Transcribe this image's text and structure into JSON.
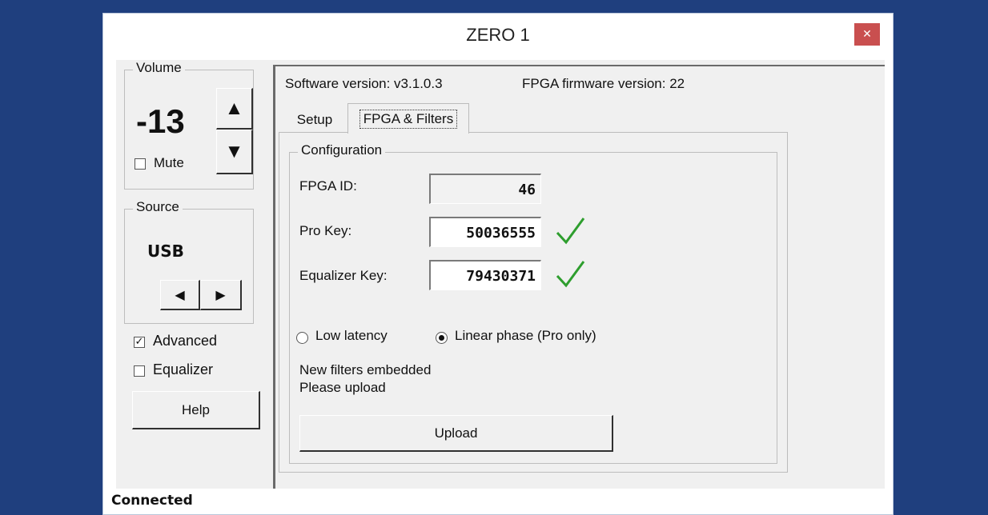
{
  "window": {
    "title": "ZERO 1",
    "close_icon": "close-icon"
  },
  "volume": {
    "label": "Volume",
    "value": "-13",
    "mute_label": "Mute",
    "mute_checked": false,
    "up_icon": "up-arrow-icon",
    "down_icon": "down-arrow-icon"
  },
  "source": {
    "label": "Source",
    "value": "USB",
    "prev_icon": "left-arrow-icon",
    "next_icon": "right-arrow-icon"
  },
  "options": {
    "advanced_label": "Advanced",
    "advanced_checked": true,
    "equalizer_label": "Equalizer",
    "equalizer_checked": false,
    "help_label": "Help"
  },
  "info": {
    "software_version": "Software version: v3.1.0.3",
    "fpga_version": "FPGA firmware version:  22"
  },
  "tabs": [
    {
      "label": "Setup",
      "active": false
    },
    {
      "label": "FPGA & Filters",
      "active": true
    }
  ],
  "config": {
    "group_label": "Configuration",
    "fpga_id_label": "FPGA ID:",
    "fpga_id_value": "46",
    "pro_key_label": "Pro Key:",
    "pro_key_value": "50036555",
    "eq_key_label": "Equalizer Key:",
    "eq_key_value": "79430371",
    "valid_icon": "checkmark-icon",
    "valid_color": "#2e9e2e",
    "low_latency_label": "Low latency",
    "linear_phase_label": "Linear phase (Pro only)",
    "selected_filter": "linear_phase",
    "message_line1": "New filters embedded",
    "message_line2": "Please upload",
    "upload_label": "Upload"
  },
  "status": {
    "text": "Connected"
  },
  "colors": {
    "desktop": "#1f3f7e",
    "close_button": "#c94f4f"
  }
}
